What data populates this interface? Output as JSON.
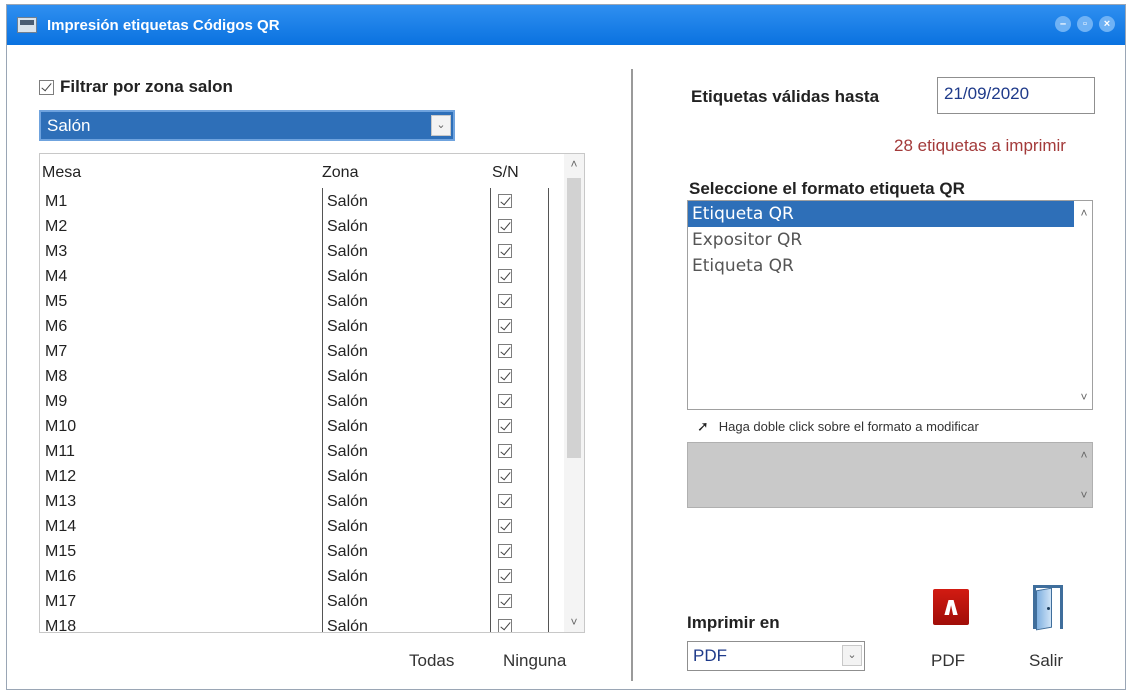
{
  "window": {
    "title": "Impresión etiquetas Códigos QR"
  },
  "filter": {
    "checkbox_label": "Filtrar por zona salon",
    "checked": true,
    "zone_selected": "Salón"
  },
  "grid": {
    "headers": {
      "mesa": "Mesa",
      "zona": "Zona",
      "sn": "S/N"
    },
    "rows": [
      {
        "mesa": "M1",
        "zona": "Salón",
        "sn": true
      },
      {
        "mesa": "M2",
        "zona": "Salón",
        "sn": true
      },
      {
        "mesa": "M3",
        "zona": "Salón",
        "sn": true
      },
      {
        "mesa": "M4",
        "zona": "Salón",
        "sn": true
      },
      {
        "mesa": "M5",
        "zona": "Salón",
        "sn": true
      },
      {
        "mesa": "M6",
        "zona": "Salón",
        "sn": true
      },
      {
        "mesa": "M7",
        "zona": "Salón",
        "sn": true
      },
      {
        "mesa": "M8",
        "zona": "Salón",
        "sn": true
      },
      {
        "mesa": "M9",
        "zona": "Salón",
        "sn": true
      },
      {
        "mesa": "M10",
        "zona": "Salón",
        "sn": true
      },
      {
        "mesa": "M11",
        "zona": "Salón",
        "sn": true
      },
      {
        "mesa": "M12",
        "zona": "Salón",
        "sn": true
      },
      {
        "mesa": "M13",
        "zona": "Salón",
        "sn": true
      },
      {
        "mesa": "M14",
        "zona": "Salón",
        "sn": true
      },
      {
        "mesa": "M15",
        "zona": "Salón",
        "sn": true
      },
      {
        "mesa": "M16",
        "zona": "Salón",
        "sn": true
      },
      {
        "mesa": "M17",
        "zona": "Salón",
        "sn": true
      },
      {
        "mesa": "M18",
        "zona": "Salón",
        "sn": true
      }
    ]
  },
  "buttons": {
    "todas": "Todas",
    "ninguna": "Ninguna",
    "pdf": "PDF",
    "salir": "Salir"
  },
  "validity": {
    "label": "Etiquetas válidas hasta",
    "date": "21/09/2020",
    "count_text": "28 etiquetas a imprimir"
  },
  "format": {
    "label": "Seleccione el formato etiqueta QR",
    "items": [
      "Etiqueta QR",
      "Expositor QR",
      "Etiqueta QR"
    ],
    "selected_index": 0,
    "hint": "Haga doble click sobre el formato a modificar"
  },
  "print": {
    "label": "Imprimir en",
    "selected": "PDF"
  },
  "colors": {
    "titlebar": "#0a72e0",
    "selection": "#2e6fb8",
    "count_text": "#a33a3a"
  }
}
